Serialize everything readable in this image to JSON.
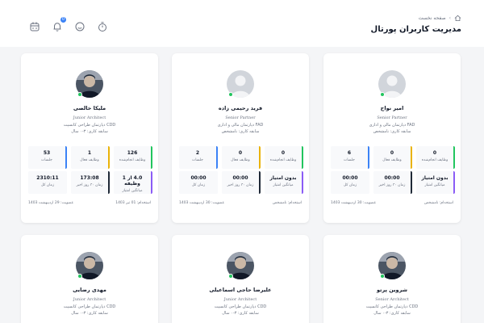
{
  "header": {
    "breadcrumb_home": "صفحه نخست",
    "title": "مدیریت کاربران پورتال",
    "notification_count": "0"
  },
  "users": [
    {
      "name": "امیر نواح",
      "role": "Senior Partner",
      "dept": "FAD دپارتمان مالی و اداری",
      "tenure": "سابقه کاری: نامشخص",
      "avatar": "placeholder",
      "stats": [
        {
          "value": "0",
          "label": "وظایف انجام‌شده"
        },
        {
          "value": "0",
          "label": "وظایف فعال"
        },
        {
          "value": "6",
          "label": "جلسات"
        },
        {
          "value": "بدون امتیاز",
          "label": "میانگین امتیاز"
        },
        {
          "value": "00:00",
          "label": "زمان ۳۰ روز اخیر"
        },
        {
          "value": "00:00",
          "label": "زمان کل"
        }
      ],
      "footer_right": "استخدام: نامشخص",
      "footer_left": "عضویت: 30 اردیبهشت 1403"
    },
    {
      "name": "فرید رحیمی زاده",
      "role": "Senior Partner",
      "dept": "FAD دپارتمان مالی و اداری",
      "tenure": "سابقه کاری: نامشخص",
      "avatar": "placeholder",
      "stats": [
        {
          "value": "0",
          "label": "وظایف انجام‌شده"
        },
        {
          "value": "0",
          "label": "وظایف فعال"
        },
        {
          "value": "2",
          "label": "جلسات"
        },
        {
          "value": "بدون امتیاز",
          "label": "میانگین امتیاز"
        },
        {
          "value": "00:00",
          "label": "زمان ۳۰ روز اخیر"
        },
        {
          "value": "00:00",
          "label": "زمان کل"
        }
      ],
      "footer_right": "استخدام: نامشخص",
      "footer_left": "عضویت: 30 اردیبهشت 1403"
    },
    {
      "name": "ملیکا خالصی",
      "role": "Junior Architect",
      "dept": "CDD دپارتمان طراحی کانسپت",
      "tenure": "سابقه کاری: ۳-۰ سال",
      "avatar": "photo",
      "stats": [
        {
          "value": "126",
          "label": "وظایف انجام‌شده"
        },
        {
          "value": "1",
          "label": "وظایف فعال"
        },
        {
          "value": "53",
          "label": "جلسات"
        },
        {
          "value": "4.0 از 1 وظیفه",
          "label": "میانگین امتیاز"
        },
        {
          "value": "173:08",
          "label": "زمان ۳۰ روز اخیر"
        },
        {
          "value": "2310:11",
          "label": "زمان کل"
        }
      ],
      "footer_right": "استخدام: 01 تیر 1403",
      "footer_left": "عضویت: 29 اردیبهشت 1403"
    },
    {
      "name": "شروین پرتو",
      "role": "Senior Architect",
      "dept": "CDD دپارتمان طراحی کانسپت",
      "tenure": "سابقه کاری: ۳-۰ سال",
      "avatar": "photo"
    },
    {
      "name": "علیرضا حاجی اسماعیلی",
      "role": "Junior Architect",
      "dept": "CDD دپارتمان طراحی کانسپت",
      "tenure": "سابقه کاری: ۳-۰ سال",
      "avatar": "photo"
    },
    {
      "name": "مهدی رضایی",
      "role": "Junior Architect",
      "dept": "CDD دپارتمان طراحی کانسپت",
      "tenure": "سابقه کاری: ۳-۰ سال",
      "avatar": "photo"
    }
  ]
}
